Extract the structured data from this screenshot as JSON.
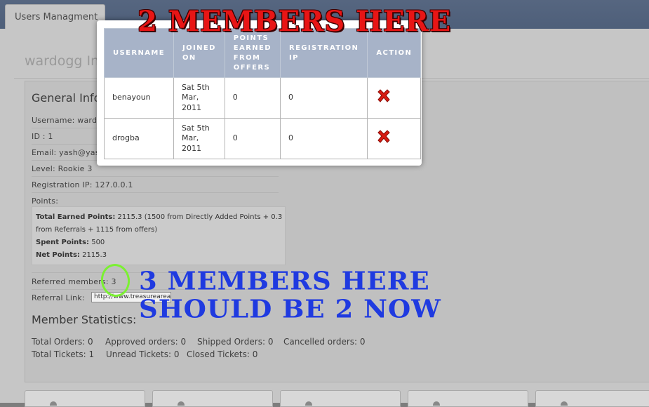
{
  "tab": {
    "label": "Users Managment"
  },
  "page": {
    "title": "wardogg In"
  },
  "general": {
    "title": "General Info",
    "username": "Username: wardo",
    "id": "ID : 1",
    "email": "Email: yash@yas",
    "level": "Level: Rookie 3",
    "registration_ip": "Registration IP: 127.0.0.1",
    "points_label": "Points:"
  },
  "points_box": {
    "total_label": "Total Earned Points:",
    "total_value": "2115.3 (1500 from Directly Added Points + 0.3",
    "total_value_cont": "from Referrals + 1115 from offers)",
    "spent_label": "Spent Points:",
    "spent_value": "500",
    "net_label": "Net Points:",
    "net_value": "2115.3"
  },
  "referrals": {
    "members_label": "Referred members:",
    "members_value": "3",
    "link_label": "Referral Link:",
    "link_value": "http://www.treasurearea.com/index.php/referra"
  },
  "stats": {
    "title": "Member Statistics:",
    "total_orders": "Total Orders: 0",
    "approved_orders": "Approved orders: 0",
    "shipped_orders": "Shipped Orders: 0",
    "cancelled_orders": "Cancelled orders: 0",
    "total_tickets": "Total Tickets: 1",
    "unread_tickets": "Unread Tickets: 0",
    "closed_tickets": "Closed Tickets: 0"
  },
  "modal": {
    "close": "×",
    "columns": [
      "USERNAME",
      "JOINED ON",
      "POINTS EARNED FROM OFFERS",
      "REGISTRATION IP",
      "ACTION"
    ],
    "rows": [
      {
        "username": "benayoun",
        "joined": "Sat 5th Mar, 2011",
        "points": "0",
        "ip": "0"
      },
      {
        "username": "drogba",
        "joined": "Sat 5th Mar, 2011",
        "points": "0",
        "ip": "0"
      }
    ]
  },
  "annotations": {
    "red": "2 MEMBERS HERE",
    "blue_line1": "3 MEMBERS HERE",
    "blue_line2": "SHOULD BE 2 NOW"
  },
  "colors": {
    "header_bar": "#566680",
    "table_header": "#a7b3c8",
    "annotation_red": "#e81515",
    "annotation_blue": "#1f3ae0",
    "circle_green": "#7bf032"
  }
}
